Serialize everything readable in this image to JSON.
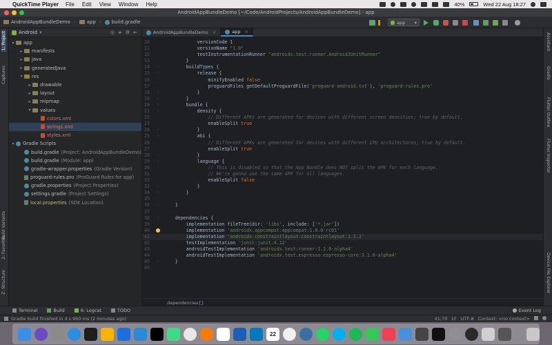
{
  "mac_menubar": {
    "app_name": "QuickTime Player",
    "menus": [
      "File",
      "Edit",
      "View",
      "Window",
      "Help"
    ],
    "battery": "40%",
    "datetime": "Wed 22 Aug  18:27"
  },
  "window": {
    "title": "AndroidAppBundleDemo [~/Code/AndroidProjects/AndroidAppBundleDemo] - app"
  },
  "navbar": {
    "breadcrumb": [
      "AndroidAppBundleDemo",
      "app",
      "build.gradle"
    ],
    "run_config": "app"
  },
  "left_tool_tabs": [
    "1: Project",
    "Captures",
    "Build Variants",
    "2: Favorites",
    "Z: Structure"
  ],
  "right_tool_tabs": [
    "Assistant",
    "Gradle",
    "Flutter Outline",
    "Flutter Inspector",
    "Device File Explorer"
  ],
  "project_panel": {
    "view_mode": "Android",
    "tree": [
      {
        "label": "app",
        "depth": 0,
        "icon": "folder-icon",
        "expanded": true
      },
      {
        "label": "manifests",
        "depth": 1,
        "icon": "folder-icon",
        "expanded": false
      },
      {
        "label": "java",
        "depth": 1,
        "icon": "folder-icon",
        "expanded": false
      },
      {
        "label": "generatedJava",
        "depth": 1,
        "icon": "folder-icon",
        "expanded": false
      },
      {
        "label": "res",
        "depth": 1,
        "icon": "folder-icon",
        "expanded": true
      },
      {
        "label": "drawable",
        "depth": 2,
        "icon": "folder-icon",
        "expanded": false
      },
      {
        "label": "layout",
        "depth": 2,
        "icon": "folder-icon",
        "expanded": false
      },
      {
        "label": "mipmap",
        "depth": 2,
        "icon": "folder-icon",
        "expanded": false
      },
      {
        "label": "values",
        "depth": 2,
        "icon": "folder-icon",
        "expanded": true
      },
      {
        "label": "colors.xml",
        "depth": 3,
        "icon": "xml-file-icon"
      },
      {
        "label": "strings.xml",
        "depth": 3,
        "icon": "xml-file-icon",
        "selected": true
      },
      {
        "label": "styles.xml",
        "depth": 3,
        "icon": "xml-file-icon"
      },
      {
        "label": "Gradle Scripts",
        "depth": 0,
        "icon": "gradle-icon",
        "expanded": true
      },
      {
        "label": "build.gradle",
        "note": "(Project: AndroidAppBundleDemo)",
        "depth": 1,
        "icon": "gradle-icon"
      },
      {
        "label": "build.gradle",
        "note": "(Module: app)",
        "depth": 1,
        "icon": "gradle-icon"
      },
      {
        "label": "gradle-wrapper.properties",
        "note": "(Gradle Version)",
        "depth": 1,
        "icon": "gradle-icon"
      },
      {
        "label": "proguard-rules.pro",
        "note": "(ProGuard Rules for app)",
        "depth": 1,
        "icon": "file-icon"
      },
      {
        "label": "gradle.properties",
        "note": "(Project Properties)",
        "depth": 1,
        "icon": "gradle-icon"
      },
      {
        "label": "settings.gradle",
        "note": "(Project Settings)",
        "depth": 1,
        "icon": "gradle-icon"
      },
      {
        "label": "local.properties",
        "note": "(SDK Location)",
        "depth": 1,
        "icon": "properties-icon",
        "warn": true
      }
    ]
  },
  "editor": {
    "tabs": [
      {
        "label": "AndroidAppBundleDemo",
        "active": false
      },
      {
        "label": "app",
        "active": true
      }
    ],
    "breadcrumb": "dependencies{}",
    "lines": [
      {
        "n": "10",
        "segs": [
          [
            "n",
            "            versionCode 1"
          ]
        ]
      },
      {
        "n": "11",
        "segs": [
          [
            "n",
            "            versionName "
          ],
          [
            "s",
            "\"1.0\""
          ]
        ]
      },
      {
        "n": "12",
        "segs": [
          [
            "n",
            "            testInstrumentationRunner "
          ],
          [
            "s",
            "\"androidx.test.runner.AndroidJUnitRunner\""
          ]
        ]
      },
      {
        "n": "13",
        "segs": [
          [
            "n",
            "        }"
          ]
        ]
      },
      {
        "n": "14",
        "segs": [
          [
            "n",
            "        buildTypes {"
          ]
        ]
      },
      {
        "n": "15",
        "segs": [
          [
            "n",
            "            release {"
          ]
        ]
      },
      {
        "n": "16",
        "segs": [
          [
            "n",
            "                minifyEnabled "
          ],
          [
            "k",
            "false"
          ]
        ]
      },
      {
        "n": "17",
        "segs": [
          [
            "n",
            "                proguardFiles getDefaultProguardFile("
          ],
          [
            "s",
            "'proguard-android.txt'"
          ],
          [
            "n",
            "), "
          ],
          [
            "s",
            "'proguard-rules.pro'"
          ]
        ]
      },
      {
        "n": "18",
        "segs": [
          [
            "n",
            "            }"
          ]
        ]
      },
      {
        "n": "19",
        "segs": [
          [
            "n",
            "        }"
          ]
        ]
      },
      {
        "n": "20",
        "segs": [
          [
            "n",
            "        bundle {"
          ]
        ]
      },
      {
        "n": "21",
        "segs": [
          [
            "n",
            "            density {"
          ]
        ]
      },
      {
        "n": "22",
        "segs": [
          [
            "c",
            "                // Different APKs are generated for devices with different screen densities; true by default."
          ]
        ]
      },
      {
        "n": "23",
        "segs": [
          [
            "n",
            "                enableSplit "
          ],
          [
            "k",
            "true"
          ]
        ]
      },
      {
        "n": "24",
        "segs": [
          [
            "n",
            "            }"
          ]
        ]
      },
      {
        "n": "25",
        "segs": [
          [
            "n",
            "            abi {"
          ]
        ]
      },
      {
        "n": "26",
        "segs": [
          [
            "c",
            "                // Different APKs are generated for devices with different CPU architectures; true by default."
          ]
        ]
      },
      {
        "n": "27",
        "segs": [
          [
            "n",
            "                enableSplit "
          ],
          [
            "k",
            "true"
          ]
        ]
      },
      {
        "n": "28",
        "segs": [
          [
            "n",
            "            }"
          ]
        ]
      },
      {
        "n": "29",
        "segs": [
          [
            "n",
            "            language {"
          ]
        ]
      },
      {
        "n": "30",
        "segs": [
          [
            "c",
            "                // This is disabled so that the App Bundle does NOT split the APK for each language."
          ]
        ]
      },
      {
        "n": "31",
        "segs": [
          [
            "c",
            "                // We're gonna use the same APK for all languages."
          ]
        ]
      },
      {
        "n": "32",
        "segs": [
          [
            "n",
            "                enableSplit "
          ],
          [
            "k",
            "false"
          ]
        ]
      },
      {
        "n": "33",
        "segs": [
          [
            "n",
            "            }"
          ]
        ]
      },
      {
        "n": "34",
        "segs": [
          [
            "n",
            "        }"
          ]
        ]
      },
      {
        "n": "35",
        "segs": [
          [
            "n",
            ""
          ]
        ]
      },
      {
        "n": "36",
        "segs": [
          [
            "n",
            "    }"
          ]
        ]
      },
      {
        "n": "37",
        "segs": [
          [
            "n",
            ""
          ]
        ]
      },
      {
        "n": "38",
        "segs": [
          [
            "n",
            "    dependencies {"
          ]
        ]
      },
      {
        "n": "39",
        "segs": [
          [
            "n",
            "        implementation fileTree(dir: "
          ],
          [
            "s",
            "'libs'"
          ],
          [
            "n",
            ", include: ["
          ],
          [
            "s",
            "'*.jar'"
          ],
          [
            "n",
            "])"
          ]
        ]
      },
      {
        "n": "40",
        "segs": [
          [
            "n",
            "        implementation "
          ],
          [
            "s",
            "'androidx.appcompat:appcompat:1.0.0-rc01'"
          ]
        ]
      },
      {
        "n": "41",
        "segs": [
          [
            "n",
            "        implementation "
          ],
          [
            "s",
            "'androidx.constraintlayout:constraintlayout:1.1.2'"
          ]
        ],
        "current": true
      },
      {
        "n": "42",
        "segs": [
          [
            "n",
            "        testImplementation "
          ],
          [
            "s",
            "'junit:junit:4.12'"
          ]
        ]
      },
      {
        "n": "43",
        "segs": [
          [
            "n",
            "        androidTestImplementation "
          ],
          [
            "s",
            "'androidx.test:runner:1.1.0-alpha4'"
          ]
        ]
      },
      {
        "n": "44",
        "segs": [
          [
            "n",
            "        androidTestImplementation "
          ],
          [
            "s",
            "'androidx.test.espresso:espresso-core:3.1.0-alpha4'"
          ]
        ]
      },
      {
        "n": "45",
        "segs": [
          [
            "n",
            "    }"
          ]
        ]
      },
      {
        "n": "46",
        "segs": [
          [
            "n",
            ""
          ]
        ]
      }
    ]
  },
  "bottom_tools": {
    "items": [
      "Terminal",
      "Build",
      "6: Logcat",
      "TODO"
    ],
    "event_log": "Event Log"
  },
  "status_bar": {
    "message": "Gradle build finished in 4 s 960 ms (2 minutes ago)",
    "position": "41:70",
    "line_sep": "LF",
    "encoding": "UTF-8",
    "context": "Context: <no context>"
  },
  "dock": {
    "apps": [
      "finder-icon",
      "siri-icon",
      "launchpad-icon",
      "safari-icon",
      "figma-icon",
      "sketch-icon",
      "xcode-icon",
      "vscode-icon",
      "intellij-icon",
      "android-studio-icon",
      "chrome-icon",
      "firefox-icon",
      "slack-icon",
      "sourcetree-icon",
      "trello-icon",
      "calendar-icon",
      "photos-icon",
      "camera-icon",
      "whatsapp-icon",
      "skype-icon",
      "spotify-icon",
      "messages-icon",
      "pocket-icon",
      "mail-icon",
      "dashboard-icon",
      "terminal-icon",
      "system-prefs-icon",
      "quicktime-icon",
      "screen-record-icon",
      "cloud-icon",
      "trash-icon"
    ],
    "calendar_day": "22",
    "accent_colors": {
      "finder": "#3a8ee6",
      "siri": "#6a4bc4",
      "launchpad": "#8a8a8a",
      "safari": "#2c8ee0",
      "figma": "#1e1e1e",
      "sketch": "#f7b500",
      "xcode": "#1d6ee0",
      "vscode": "#2a8ad4",
      "intellij": "#000000",
      "android-studio": "#3ddc84",
      "chrome": "#e8e8e8",
      "firefox": "#ff7a00",
      "slack": "#ffffff",
      "sourcetree": "#1a5fb4",
      "trello": "#0079bf",
      "calendar": "#ffffff",
      "photos": "#f0f0f0",
      "camera": "#3a6ea5",
      "whatsapp": "#25d366",
      "skype": "#00aff0",
      "spotify": "#1db954",
      "messages": "#35c759",
      "pocket": "#ef4056",
      "mail": "#4a90d9",
      "dashboard": "#444444",
      "terminal": "#111111",
      "system-prefs": "#8e8e93",
      "quicktime": "#2a2a2a",
      "screen-record": "#d0d0d0",
      "cloud": "#555555",
      "trash": "#c8c8c8"
    }
  }
}
